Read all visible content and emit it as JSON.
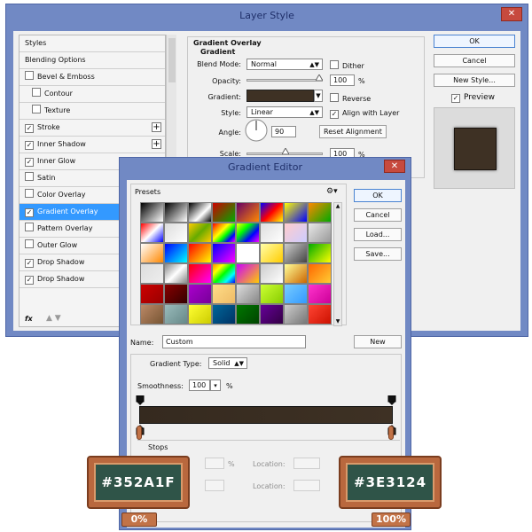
{
  "layer_style": {
    "title": "Layer Style",
    "close": "✕",
    "sidebar": [
      {
        "label": "Styles",
        "checkbox": false,
        "checked": false,
        "indent": false,
        "plus": false,
        "selected": false
      },
      {
        "label": "Blending Options",
        "checkbox": false,
        "checked": false,
        "indent": false,
        "plus": false,
        "selected": false
      },
      {
        "label": "Bevel & Emboss",
        "checkbox": true,
        "checked": false,
        "indent": false,
        "plus": false,
        "selected": false
      },
      {
        "label": "Contour",
        "checkbox": true,
        "checked": false,
        "indent": true,
        "plus": false,
        "selected": false
      },
      {
        "label": "Texture",
        "checkbox": true,
        "checked": false,
        "indent": true,
        "plus": false,
        "selected": false
      },
      {
        "label": "Stroke",
        "checkbox": true,
        "checked": true,
        "indent": false,
        "plus": true,
        "selected": false
      },
      {
        "label": "Inner Shadow",
        "checkbox": true,
        "checked": true,
        "indent": false,
        "plus": true,
        "selected": false
      },
      {
        "label": "Inner Glow",
        "checkbox": true,
        "checked": true,
        "indent": false,
        "plus": false,
        "selected": false
      },
      {
        "label": "Satin",
        "checkbox": true,
        "checked": false,
        "indent": false,
        "plus": false,
        "selected": false
      },
      {
        "label": "Color Overlay",
        "checkbox": true,
        "checked": false,
        "indent": false,
        "plus": false,
        "selected": false
      },
      {
        "label": "Gradient Overlay",
        "checkbox": true,
        "checked": true,
        "indent": false,
        "plus": false,
        "selected": true
      },
      {
        "label": "Pattern Overlay",
        "checkbox": true,
        "checked": false,
        "indent": false,
        "plus": false,
        "selected": false
      },
      {
        "label": "Outer Glow",
        "checkbox": true,
        "checked": false,
        "indent": false,
        "plus": false,
        "selected": false
      },
      {
        "label": "Drop Shadow",
        "checkbox": true,
        "checked": true,
        "indent": false,
        "plus": false,
        "selected": false
      },
      {
        "label": "Drop Shadow",
        "checkbox": true,
        "checked": true,
        "indent": false,
        "plus": false,
        "selected": false
      }
    ],
    "fx_label": "fx",
    "section_title": "Gradient Overlay",
    "section_sub": "Gradient",
    "blend_mode_label": "Blend Mode:",
    "blend_mode_value": "Normal",
    "dither_label": "Dither",
    "opacity_label": "Opacity:",
    "opacity_value": "100",
    "percent": "%",
    "gradient_label": "Gradient:",
    "reverse_label": "Reverse",
    "style_label": "Style:",
    "style_value": "Linear",
    "align_label": "Align with Layer",
    "angle_label": "Angle:",
    "angle_value": "90",
    "reset_alignment": "Reset Alignment",
    "scale_label": "Scale:",
    "scale_value": "100",
    "ok": "OK",
    "cancel": "Cancel",
    "new_style": "New Style...",
    "preview_label": "Preview",
    "preview_color": "#3e3124"
  },
  "gradient_editor": {
    "title": "Gradient Editor",
    "close": "✕",
    "presets_label": "Presets",
    "gear_icon": "gear-icon",
    "ok": "OK",
    "cancel": "Cancel",
    "load": "Load...",
    "save": "Save...",
    "name_label": "Name:",
    "name_value": "Custom",
    "new_button": "New",
    "gradient_type_label": "Gradient Type:",
    "gradient_type_value": "Solid",
    "smoothness_label": "Smoothness:",
    "smoothness_value": "100",
    "percent": "%",
    "stops_label": "Stops",
    "location_label": "Location:",
    "start_color": "#352a1f",
    "end_color": "#3e3124"
  },
  "annotations": {
    "left_color": "#352A1F",
    "left_location": "0%",
    "right_color": "#3E3124",
    "right_location": "100%"
  },
  "presets_swatches": [
    "linear-gradient(135deg,#000,#fff)",
    "linear-gradient(135deg,#000,#fff)",
    "linear-gradient(135deg,#000,#fff 60%,#000)",
    "linear-gradient(135deg,#c00,#0a0)",
    "linear-gradient(135deg,#606,#f80)",
    "linear-gradient(135deg,#00f,#f00,#ff0)",
    "linear-gradient(135deg,#ff0,#00f)",
    "linear-gradient(135deg,#f80,#0a0)",
    "linear-gradient(135deg,#f00,#fff,#00f)",
    "linear-gradient(135deg,#dcdcdc,#fff)",
    "linear-gradient(135deg,#fc0,#6a0 50%,#fc0)",
    "linear-gradient(135deg,#f00,#f80,#ff0,#0f0,#00f,#f0f)",
    "linear-gradient(135deg,#ff0,#0f0,#00f,#f0f)",
    "linear-gradient(135deg,#ddd,#fff)",
    "linear-gradient(135deg,#fcc,#ccf)",
    "linear-gradient(135deg,#e8e8e8,#999)",
    "linear-gradient(135deg,#fff,#f80)",
    "linear-gradient(135deg,#00f,#0ff)",
    "linear-gradient(135deg,#f00,#ff0)",
    "linear-gradient(135deg,#00f,#f0f)",
    "linear-gradient(135deg,#fff,#fff)",
    "linear-gradient(135deg,#ffa,#fc0)",
    "linear-gradient(135deg,#ccc,#444)",
    "linear-gradient(135deg,#0a0,#ff0)",
    "linear-gradient(135deg,#ddd,#eee)",
    "linear-gradient(135deg,#888,#fff,#888)",
    "linear-gradient(135deg,#f00,#f0f)",
    "linear-gradient(135deg,#f80,#ff0,#0f0,#0ff,#00f)",
    "linear-gradient(135deg,#c0f,#fc0)",
    "linear-gradient(135deg,#ccc,#fff)",
    "linear-gradient(135deg,#ff9,#c60)",
    "linear-gradient(135deg,#f60,#fc3)",
    "linear-gradient(135deg,#c00,#900)",
    "linear-gradient(135deg,#800,#300)",
    "linear-gradient(135deg,#a0c,#709)",
    "linear-gradient(135deg,#fd8,#eb6)",
    "linear-gradient(135deg,#ddd,#888)",
    "linear-gradient(135deg,#cf3,#8c0)",
    "linear-gradient(135deg,#7cf,#39f)",
    "linear-gradient(135deg,#f3c,#c09)",
    "linear-gradient(135deg,#b86,#753)",
    "linear-gradient(135deg,#9bb,#688)",
    "linear-gradient(135deg,#ff3,#cc0)",
    "linear-gradient(135deg,#069,#036)",
    "linear-gradient(135deg,#070,#040)",
    "linear-gradient(135deg,#609,#304)",
    "linear-gradient(135deg,#ccc,#777)",
    "linear-gradient(135deg,#f43,#c10)"
  ]
}
